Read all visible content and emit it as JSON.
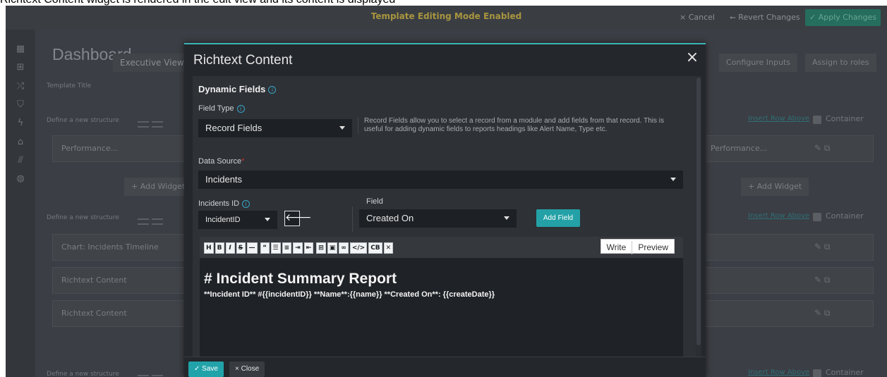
{
  "page_caption": "Richtext Content widget is rendered in the edit view and its content is displayed",
  "topbar": {
    "mode_text": "Template Editing Mode Enabled",
    "cancel_label": "× Cancel",
    "revert_label": "⭠ Revert Changes",
    "apply_label": "✓ Apply Changes"
  },
  "sidebar": {
    "icons": [
      "dashboard-icon",
      "sitemap-icon",
      "shuffle-icon",
      "shield-icon",
      "bolt-icon",
      "bank-icon",
      "chart-icon",
      "globe-icon"
    ]
  },
  "dashboard": {
    "title": "Dashboard",
    "template_title_label": "Template Title",
    "template_title_value": "Executive View",
    "configure_inputs_label": "Configure Inputs",
    "assign_roles_label": "Assign to roles",
    "define_structure_label": "Define a new structure",
    "insert_row_above_label": "Insert Row Above",
    "container_label": "Container",
    "add_widget_label": "+ Add Widget",
    "rows": [
      {
        "left": "Performance...",
        "right": "Performance..."
      },
      {
        "left": "Chart: Incidents Timeline"
      },
      {
        "left": "Richtext Content"
      },
      {
        "left": "Richtext Content"
      }
    ]
  },
  "modal": {
    "title": "Richtext Content",
    "close_glyph": "×",
    "section_title": "Dynamic Fields",
    "field_type": {
      "label": "Field Type",
      "value": "Record Fields",
      "help": "Record Fields allow you to select a record from a module and add fields from that record. This is useful for adding dynamic fields to reports headings like Alert Name, Type etc."
    },
    "data_source": {
      "label": "Data Source",
      "required_mark": "*",
      "value": "Incidents"
    },
    "incidents_id": {
      "label": "Incidents ID",
      "value": "IncidentID"
    },
    "field": {
      "label": "Field",
      "value": "Created On"
    },
    "arrow_glyph": "🡐",
    "add_field_label": "Add Field",
    "toolbar": [
      "H",
      "B",
      "I",
      "S",
      "—",
      "“",
      "☰",
      "≡",
      "⇥",
      "⇤",
      "⊞",
      "▣",
      "∞",
      "</>",
      "CB",
      "✕"
    ],
    "write_label": "Write",
    "preview_label": "Preview",
    "editor": {
      "heading": "# Incident Summary Report",
      "body": "**Incident ID** #{{incidentID}} **Name**:{{name}} **Created On**: {{createDate}}"
    },
    "save_label": "✓ Save",
    "close_label": "× Close"
  },
  "colors": {
    "accent": "#23a1a6",
    "modal_bg": "#24272c",
    "body_bg": "#2e3136",
    "mode_text": "#a8953e"
  }
}
